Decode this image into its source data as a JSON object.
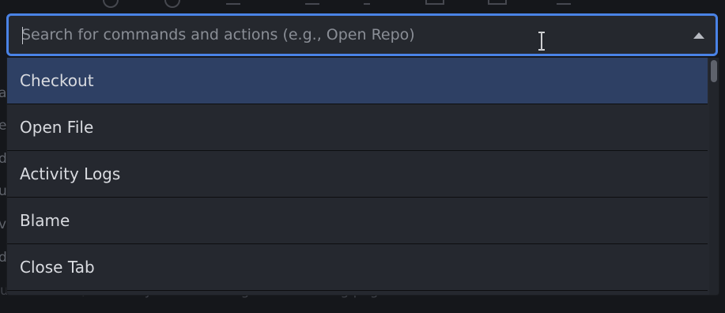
{
  "search": {
    "placeholder": "Search for commands and actions (e.g., Open Repo)",
    "value": ""
  },
  "commands": [
    {
      "label": "Checkout",
      "active": true
    },
    {
      "label": "Open File",
      "active": false
    },
    {
      "label": "Activity Logs",
      "active": false
    },
    {
      "label": "Blame",
      "active": false
    },
    {
      "label": "Close Tab",
      "active": false
    }
  ],
  "background": {
    "left_fragments": [
      "a",
      "er",
      "di",
      "ue",
      "vs",
      "di"
    ],
    "bottom_text": "uest rrees w/omhiousyNnknlow-intogt...rsks landing page"
  },
  "colors": {
    "focus_border": "#4a83e6",
    "active_item": "#2e4064",
    "panel": "#25282f"
  },
  "icons": {
    "dropdown": "chevron-up-icon",
    "cursor": "text-cursor-icon"
  }
}
